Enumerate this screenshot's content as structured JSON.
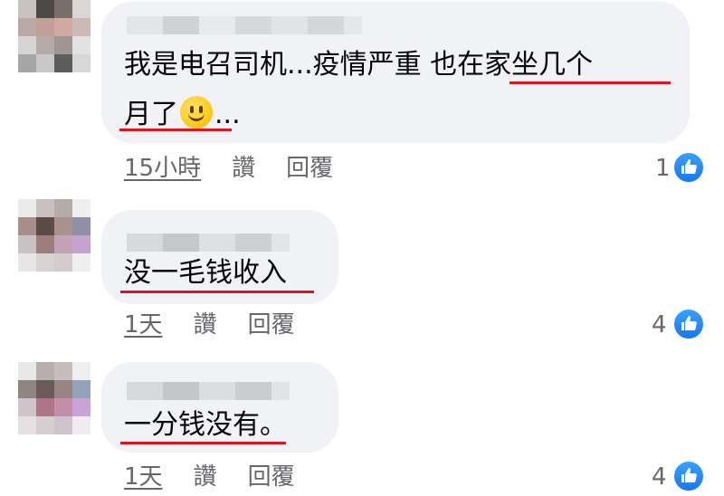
{
  "colors": {
    "bubble": "#f0f2f5",
    "meta_text": "#65676b",
    "underline": "#e0141e",
    "like_blue": "#1877f2"
  },
  "comments": [
    {
      "text_line1": "我是电召司机...疫情严重 也在家坐几个",
      "text_line2": "月了",
      "text_line2_after_emoji": "...",
      "emoji": "slightly-smiling-face-icon",
      "time": "15小時",
      "like_label": "讚",
      "reply_label": "回覆",
      "reaction_count": "1",
      "reaction_icon": "thumbs-up-icon"
    },
    {
      "text_line1": "没一毛钱收入",
      "time": "1天",
      "like_label": "讚",
      "reply_label": "回覆",
      "reaction_count": "4",
      "reaction_icon": "thumbs-up-icon"
    },
    {
      "text_line1": "一分钱没有。",
      "time": "1天",
      "like_label": "讚",
      "reply_label": "回覆",
      "reaction_count": "4",
      "reaction_icon": "thumbs-up-icon"
    }
  ]
}
